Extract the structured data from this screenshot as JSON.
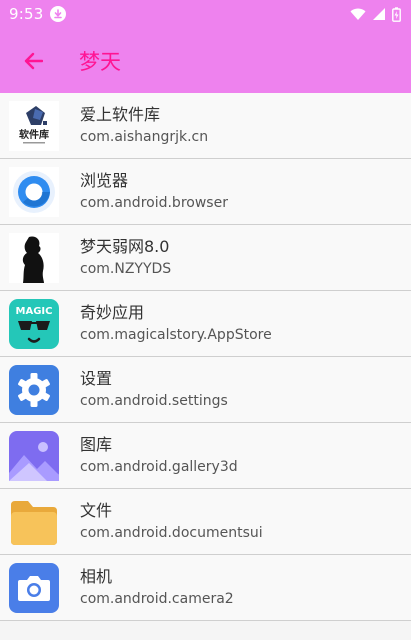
{
  "status_bar": {
    "time": "9:53",
    "icons": [
      "download-icon",
      "wifi-icon",
      "signal-icon",
      "battery-icon"
    ]
  },
  "header": {
    "title": "梦天",
    "back_icon": "back-arrow-icon",
    "background": "#ee82ee",
    "title_color": "#ff1493"
  },
  "apps": [
    {
      "name": "爱上软件库",
      "package": "com.aishangrjk.cn",
      "icon": "software-library-icon",
      "icon_text": "软件库"
    },
    {
      "name": "浏览器",
      "package": "com.android.browser",
      "icon": "browser-icon"
    },
    {
      "name": "梦天弱网8.0",
      "package": "com.NZYYDS",
      "icon": "silhouette-icon"
    },
    {
      "name": "奇妙应用",
      "package": "com.magicalstory.AppStore",
      "icon": "magic-app-icon",
      "icon_text": "MAGIC"
    },
    {
      "name": "设置",
      "package": "com.android.settings",
      "icon": "settings-gear-icon"
    },
    {
      "name": "图库",
      "package": "com.android.gallery3d",
      "icon": "gallery-icon"
    },
    {
      "name": "文件",
      "package": "com.android.documentsui",
      "icon": "folder-icon"
    },
    {
      "name": "相机",
      "package": "com.android.camera2",
      "icon": "camera-icon"
    }
  ]
}
